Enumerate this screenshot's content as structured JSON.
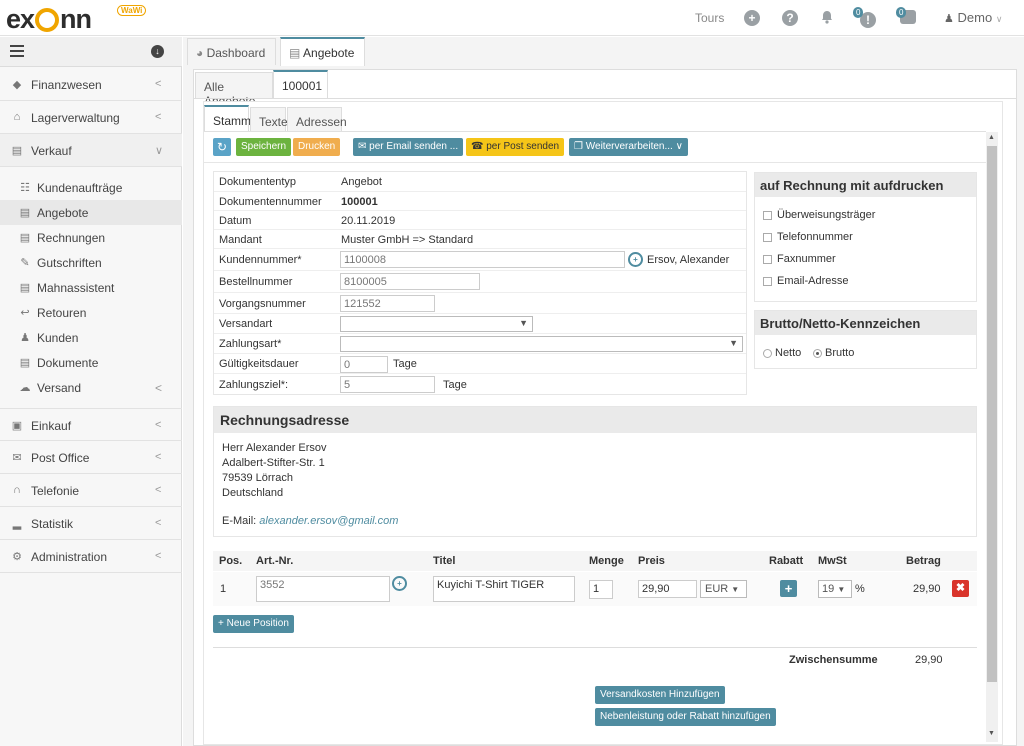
{
  "topbar": {
    "logo_pre": "ex",
    "logo_post": "nn",
    "logo_badge": "WaWi",
    "tours": "Tours",
    "badge1": "0",
    "badge2": "0",
    "user": "Demo"
  },
  "sidebar": {
    "items": [
      {
        "label": "Finanzwesen",
        "icon": "finance-icon"
      },
      {
        "label": "Lagerverwaltung",
        "icon": "warehouse-icon"
      },
      {
        "label": "Verkauf",
        "icon": "cart-icon"
      }
    ],
    "subitems": [
      {
        "label": "Kundenaufträge",
        "icon": "orders-icon"
      },
      {
        "label": "Angebote",
        "icon": "offer-icon"
      },
      {
        "label": "Rechnungen",
        "icon": "invoice-icon"
      },
      {
        "label": "Gutschriften",
        "icon": "credit-icon"
      },
      {
        "label": "Mahnassistent",
        "icon": "reminder-icon"
      },
      {
        "label": "Retouren",
        "icon": "return-icon"
      },
      {
        "label": "Kunden",
        "icon": "user-icon"
      },
      {
        "label": "Dokumente",
        "icon": "document-icon"
      },
      {
        "label": "Versand",
        "icon": "shipping-icon"
      }
    ],
    "bottom": [
      {
        "label": "Einkauf",
        "icon": "purchase-icon"
      },
      {
        "label": "Post Office",
        "icon": "mail-icon"
      },
      {
        "label": "Telefonie",
        "icon": "headset-icon"
      },
      {
        "label": "Statistik",
        "icon": "chart-icon"
      },
      {
        "label": "Administration",
        "icon": "gears-icon"
      }
    ]
  },
  "tabs": {
    "dashboard": "Dashboard",
    "angebote": "Angebote",
    "alle": "Alle Angebote",
    "doc": "100001",
    "stamm": "Stamm",
    "texte": "Texte",
    "adressen": "Adressen"
  },
  "toolbar": {
    "save": "Speichern",
    "print": "Drucken",
    "email": "per Email senden ...",
    "post": "per Post senden",
    "further": "Weiterverarbeiten..."
  },
  "form": {
    "doctype_k": "Dokumententyp",
    "doctype_v": "Angebot",
    "docnum_k": "Dokumentennummer",
    "docnum_v": "100001",
    "date_k": "Datum",
    "date_v": "20.11.2019",
    "mandant_k": "Mandant",
    "mandant_v": "Muster GmbH => Standard",
    "kunde_k": "Kundennummer*",
    "kunde_v": "1100008",
    "kunde_name": "Ersov, Alexander",
    "bestell_k": "Bestellnummer",
    "bestell_v": "8100005",
    "vorgang_k": "Vorgangsnummer",
    "vorgang_v": "121552",
    "versand_k": "Versandart",
    "zahlart_k": "Zahlungsart*",
    "gueltig_k": "Gültigkeitsdauer",
    "gueltig_v": "0",
    "gueltig_u": "Tage",
    "ziel_k": "Zahlungsziel*:",
    "ziel_v": "5",
    "ziel_u": "Tage"
  },
  "print_box": {
    "title": "auf Rechnung mit aufdrucken",
    "opts": [
      "Überweisungsträger",
      "Telefonnummer",
      "Faxnummer",
      "Email-Adresse"
    ]
  },
  "brutto_box": {
    "title": "Brutto/Netto-Kennzeichen",
    "netto": "Netto",
    "brutto": "Brutto",
    "selected": "Brutto"
  },
  "address": {
    "title": "Rechnungsadresse",
    "l1": "Herr Alexander Ersov",
    "l2": "Adalbert-Stifter-Str. 1",
    "l3": "79539 Lörrach",
    "l4": "Deutschland",
    "email_label": "E-Mail:",
    "email": "alexander.ersov@gmail.com"
  },
  "positions": {
    "headers": [
      "Pos.",
      "Art.-Nr.",
      "Titel",
      "Menge",
      "Preis",
      "Rabatt",
      "MwSt",
      "Betrag"
    ],
    "rows": [
      {
        "pos": "1",
        "art": "3552",
        "titel": "Kuyichi T-Shirt TIGER",
        "menge": "1",
        "preis": "29,90",
        "currency": "EUR",
        "mwst": "19",
        "pct": "%",
        "betrag": "29,90"
      }
    ],
    "new_position": "+ Neue Position",
    "subtotal_label": "Zwischensumme",
    "subtotal": "29,90",
    "add_shipping": "Versandkosten Hinzufügen",
    "add_service": "Nebenleistung oder Rabatt hinzufügen"
  }
}
